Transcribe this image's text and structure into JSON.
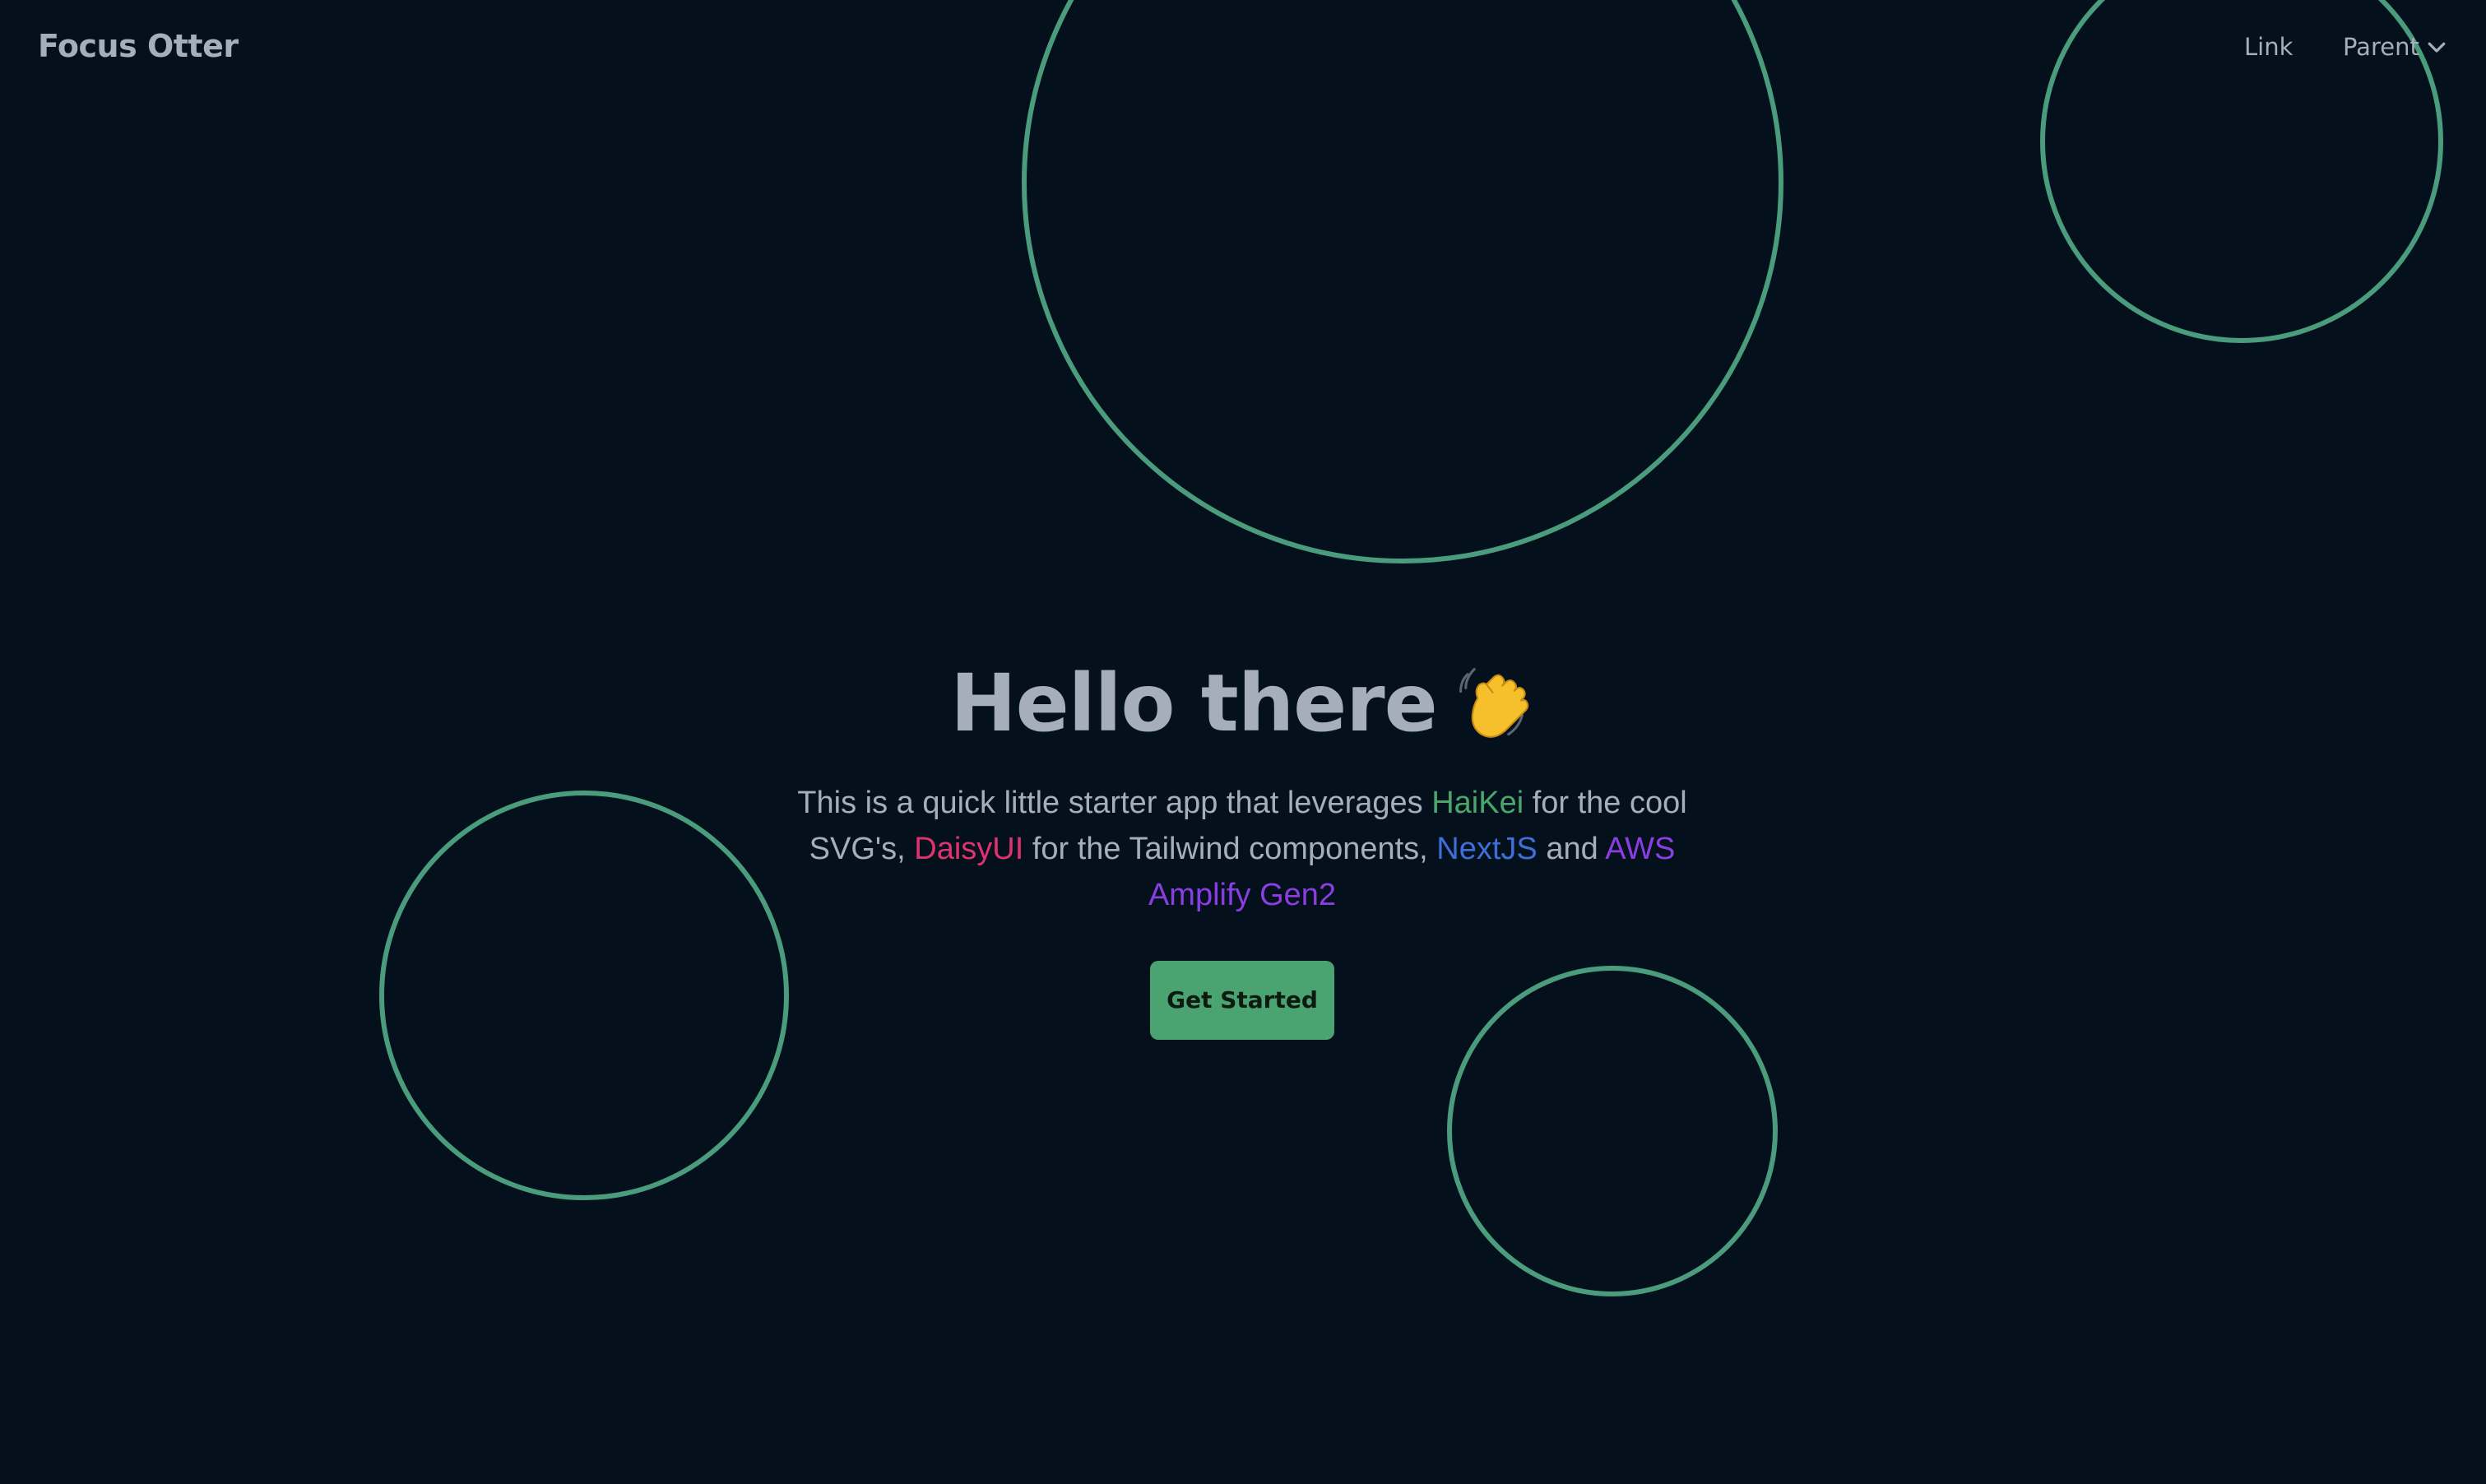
{
  "navbar": {
    "brand": "Focus Otter",
    "link_label": "Link",
    "parent_label": "Parent"
  },
  "hero": {
    "title": "Hello there",
    "desc_1": "This is a quick little starter app that leverages ",
    "haikei": "HaiKei",
    "desc_2": " for the cool SVG's, ",
    "daisyui": "DaisyUI",
    "desc_3": " for the Tailwind components, ",
    "nextjs": "NextJS",
    "desc_4": " and ",
    "aws": "AWS Amplify Gen2",
    "cta_label": "Get Started"
  },
  "icons": {
    "wave": "waving-hand-icon",
    "dropdown": "chevron-down-icon"
  },
  "colors": {
    "background": "#04111d",
    "circle_stroke": "#4a9c7c",
    "text": "#a6adbb",
    "haikei": "#4aa66a",
    "daisyui": "#e0326f",
    "nextjs": "#3f6ed8",
    "aws": "#8a3ee2",
    "button": "#4aa370"
  }
}
